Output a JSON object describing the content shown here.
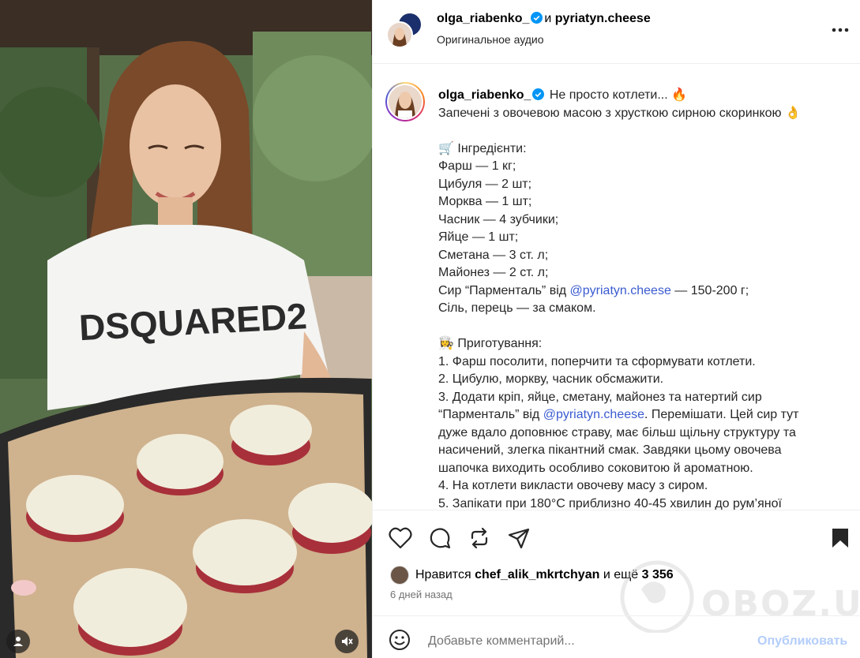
{
  "header": {
    "author": "olga_riabenko_",
    "and": "и",
    "collaborator": "pyriatyn.cheese",
    "audio": "Оригинальное аудио"
  },
  "caption": {
    "username": "olga_riabenko_",
    "lines": [
      "Не просто котлети... 🔥",
      "Запечені з овочевою масою з хрусткою сирною скоринкою 👌",
      "",
      "🛒 Інгредієнти:",
      "Фарш — 1 кг;",
      "Цибуля — 2 шт;",
      "Морква — 1 шт;",
      "Часник — 4 зубчики;",
      "Яйце — 1 шт;",
      "Сметана — 3 ст. л;",
      "Майонез — 2 ст. л;",
      "Сир “Парменталь” від",
      "Сіль, перець — за смаком.",
      "",
      "👩‍🍳 Приготування:",
      "1. Фарш посолити, поперчити та сформувати котлети.",
      "2. Цибулю, моркву, часник обсмажити.",
      "3. Додати кріп, яйце, сметану, майонез та натертий сир",
      "“Парменталь” від",
      "дуже вдало доповнює страву, має більш щільну структуру та",
      "насичений, злегка пікантний смак. Завдяки цьому овочева",
      "шапочка виходить особливо соковитою й ароматною.",
      "4. На котлети викласти овочеву масу з сиром.",
      "5. Запікати при 180°C приблизно 40-45 хвилин до рум’яної"
    ],
    "mention": "@pyriatyn.cheese",
    "cheese_amount": "— 150-200 г;",
    "after_mention": ". Перемішати. Цей сир тут"
  },
  "engagement": {
    "likes_prefix": "Нравится",
    "likes_user": "chef_alik_mkrtchyan",
    "likes_middle": "и ещё",
    "likes_count": "3 356",
    "time_ago": "6 дней назад"
  },
  "comment": {
    "placeholder": "Добавьте комментарий...",
    "post_label": "Опубликовать"
  },
  "watermark": {
    "text": "OBOZ.UA"
  },
  "colors": {
    "mention": "#3a5bd0",
    "post_disabled": "#b3cdfb",
    "verified": "#0095f6",
    "muted_text": "#737373"
  },
  "icons": [
    "verified-icon",
    "more-icon",
    "heart-icon",
    "comment-icon",
    "repost-icon",
    "share-icon",
    "bookmark-icon",
    "emoji-icon",
    "user-icon",
    "mute-icon"
  ]
}
